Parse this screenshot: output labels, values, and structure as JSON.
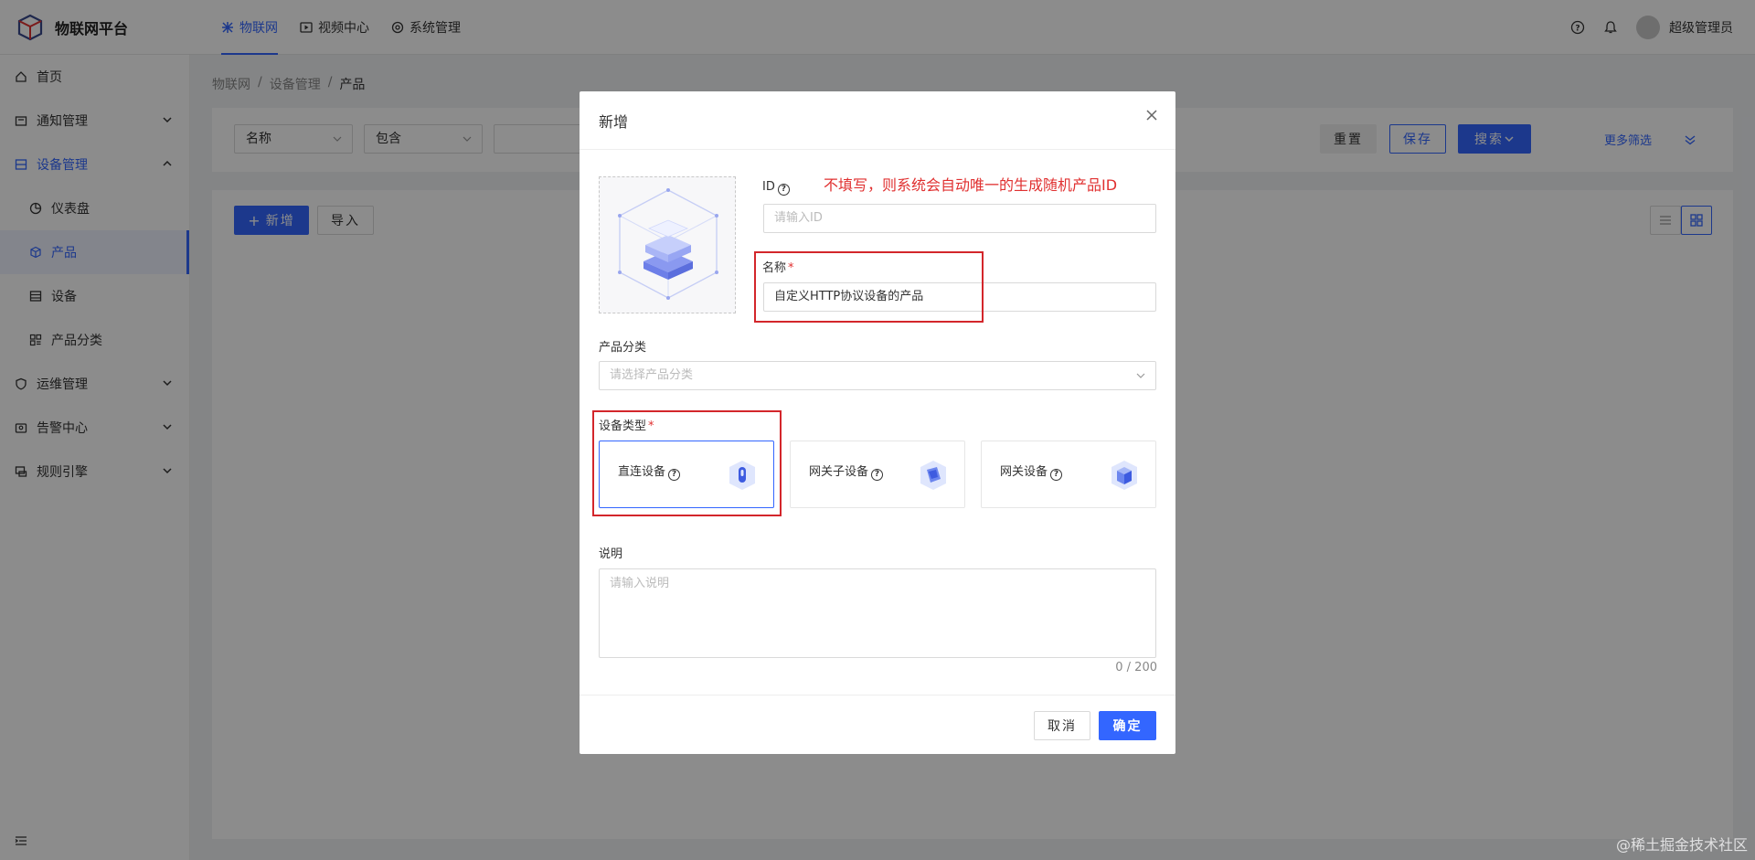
{
  "app": {
    "title": "物联网平台"
  },
  "topnav": [
    {
      "label": "物联网",
      "icon": "network-icon"
    },
    {
      "label": "视频中心",
      "icon": "video-icon"
    },
    {
      "label": "系统管理",
      "icon": "settings-icon"
    }
  ],
  "user": {
    "name": "超级管理员"
  },
  "sidebar": {
    "items": [
      {
        "label": "首页"
      },
      {
        "label": "通知管理"
      },
      {
        "label": "设备管理"
      },
      {
        "label": "仪表盘"
      },
      {
        "label": "产品"
      },
      {
        "label": "设备"
      },
      {
        "label": "产品分类"
      },
      {
        "label": "运维管理"
      },
      {
        "label": "告警中心"
      },
      {
        "label": "规则引擎"
      }
    ]
  },
  "breadcrumb": [
    "物联网",
    "/",
    "设备管理",
    "/",
    "产品"
  ],
  "filter": {
    "field": "名称",
    "operator": "包含",
    "reset": "重置",
    "save": "保存",
    "search": "搜索",
    "more": "更多筛选"
  },
  "toolbar": {
    "add": "新增",
    "import": "导入"
  },
  "modal": {
    "title": "新增",
    "id_label": "ID",
    "id_placeholder": "请输入ID",
    "annotation": "不填写，则系统会自动唯一的生成随机产品ID",
    "name_label": "名称",
    "name_value": "自定义HTTP协议设备的产品",
    "category_label": "产品分类",
    "category_placeholder": "请选择产品分类",
    "device_type_label": "设备类型",
    "device_types": [
      "直连设备",
      "网关子设备",
      "网关设备"
    ],
    "desc_label": "说明",
    "desc_placeholder": "请输入说明",
    "counter": "0 / 200",
    "cancel": "取消",
    "confirm": "确定"
  },
  "watermark": "@稀土掘金技术社区",
  "colors": {
    "primary": "#3366ff",
    "annotation": "#e03030"
  }
}
